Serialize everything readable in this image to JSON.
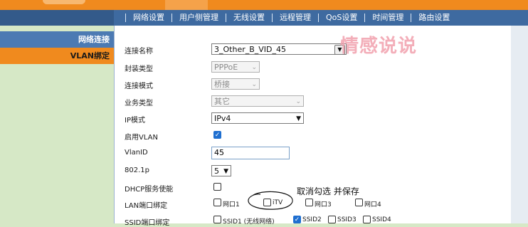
{
  "colors": {
    "top_orange": "#f08a1e",
    "subnav_blue": "#3e6aa0",
    "sidebar_blue": "#4c7ab3",
    "checkbox_checked": "#1f6fd0",
    "watermark_pink": "#f2a0ad"
  },
  "subnav": {
    "items": [
      {
        "label": "网络设置"
      },
      {
        "label": "用户侧管理"
      },
      {
        "label": "无线设置"
      },
      {
        "label": "远程管理"
      },
      {
        "label": "QoS设置"
      },
      {
        "label": "时间管理"
      },
      {
        "label": "路由设置"
      }
    ]
  },
  "sidebar": {
    "items": [
      {
        "label": "网络连接"
      },
      {
        "label": "VLAN绑定"
      }
    ]
  },
  "watermark": "情感说说",
  "form": {
    "connection_name": {
      "label": "连接名称",
      "value": "3_Other_B_VID_45"
    },
    "encapsulation": {
      "label": "封装类型",
      "value": "PPPoE"
    },
    "connection_mode": {
      "label": "连接模式",
      "value": "桥接"
    },
    "service_type": {
      "label": "业务类型",
      "value": "其它"
    },
    "ip_mode": {
      "label": "IP模式",
      "value": "IPv4"
    },
    "enable_vlan": {
      "label": "启用VLAN",
      "checked": true
    },
    "vlan_id": {
      "label": "VlanID",
      "value": "45"
    },
    "dot1p": {
      "label": "802.1p",
      "value": "5"
    },
    "dhcp": {
      "label": "DHCP服务使能",
      "checked": false
    },
    "lan_binding": {
      "label": "LAN端口绑定",
      "ports": [
        {
          "label": "网口1",
          "checked": false
        },
        {
          "label": "iTV",
          "checked": false
        },
        {
          "label": "网口3",
          "checked": false
        },
        {
          "label": "网口4",
          "checked": false
        }
      ]
    },
    "ssid_binding": {
      "label": "SSID端口绑定",
      "ssids": [
        {
          "label": "SSID1 (无线网络)",
          "checked": false
        },
        {
          "label": "SSID2",
          "checked": true
        },
        {
          "label": "SSID3",
          "checked": false
        },
        {
          "label": "SSID4",
          "checked": false
        }
      ]
    }
  },
  "annotation": "取消勾选 并保存"
}
